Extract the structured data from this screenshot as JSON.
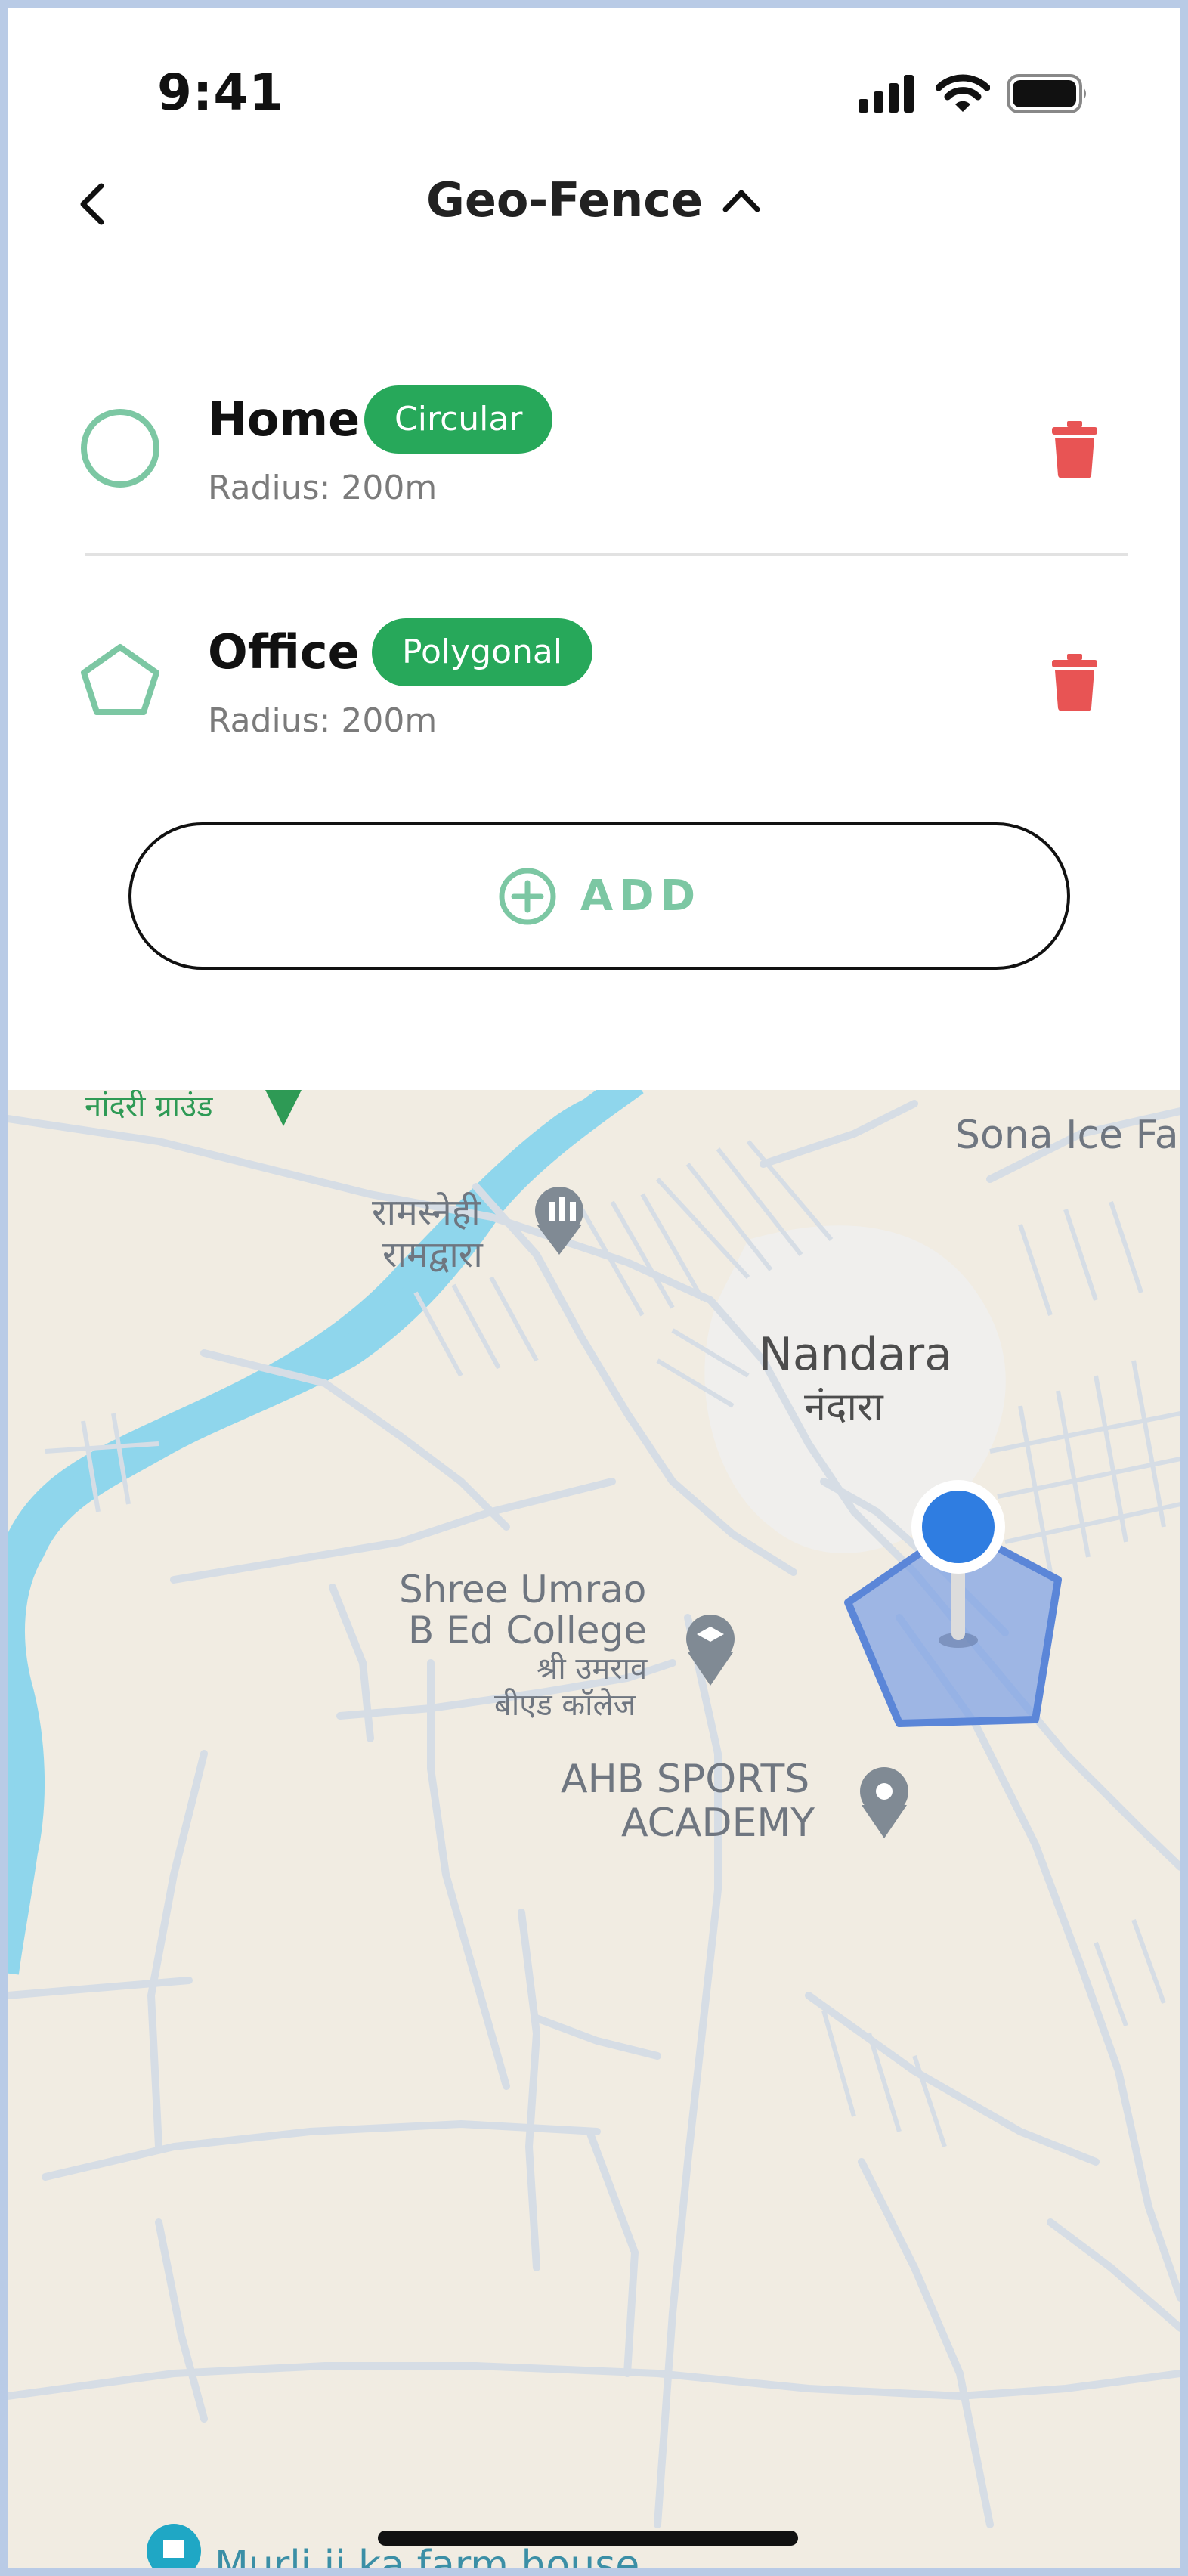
{
  "status_bar": {
    "time": "9:41",
    "icons": [
      "cellular-signal-icon",
      "wifi-icon",
      "battery-icon"
    ]
  },
  "header": {
    "title": "Geo-Fence",
    "back_icon": "chevron-left-icon",
    "toggle_icon": "chevron-up-icon"
  },
  "fences": [
    {
      "name": "Home",
      "type": "Circular",
      "radius": "Radius: 200m",
      "shape_icon": "circle-icon"
    },
    {
      "name": "Office",
      "type": "Polygonal",
      "radius": "Radius: 200m",
      "shape_icon": "pentagon-icon"
    }
  ],
  "add_button": {
    "label": "ADD",
    "icon": "plus-circle-icon"
  },
  "map": {
    "labels": {
      "nandri_ground": "नांदरी ग्राउंड",
      "sona_ice": "Sona Ice Fa",
      "ramsnehi_1": "रामस्नेही",
      "ramsnehi_2": "रामद्वारा",
      "nandara_en": "Nandara",
      "nandara_hi": "नंदारा",
      "college_1": "Shree Umrao",
      "college_2": "B Ed College",
      "college_hi_1": "श्री उमराव",
      "college_hi_2": "बीएड कॉलेज",
      "academy_1": "AHB SPORTS",
      "academy_2": "ACADEMY",
      "farm_house": "Murli ji ka farm house"
    },
    "colors": {
      "accent": "#27a85a",
      "shape": "#7cc7a3",
      "delete": "#e85454",
      "fence_fill": "#7a9fe6",
      "pin": "#2f7de1",
      "water": "#8fd6ec"
    }
  }
}
